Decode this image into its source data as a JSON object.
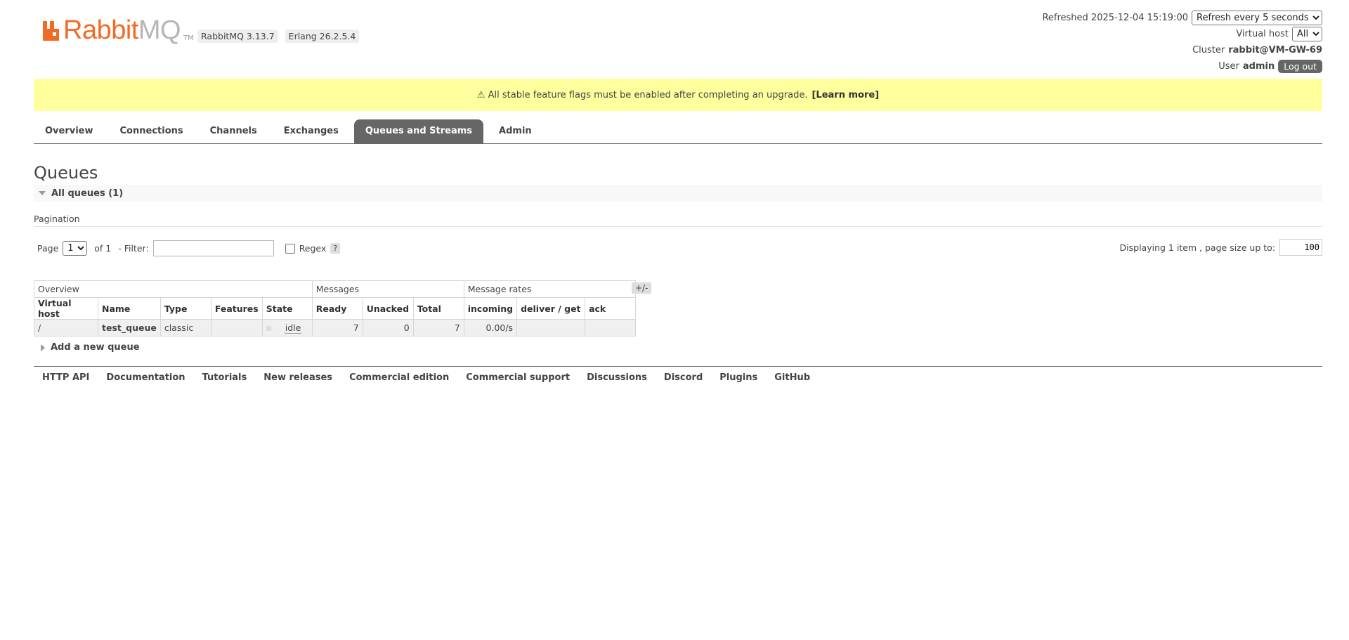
{
  "header": {
    "logo_rabbit": "Rabbit",
    "logo_mq": "MQ",
    "logo_tm": "TM",
    "rabbitmq_version": "RabbitMQ 3.13.7",
    "erlang_version": "Erlang 26.2.5.4"
  },
  "status": {
    "refreshed": "Refreshed 2025-12-04 15:19:00",
    "refresh_option": "Refresh every 5 seconds",
    "vhost_label": "Virtual host",
    "vhost_value": "All",
    "cluster_label": "Cluster",
    "cluster_value": "rabbit@VM-GW-69",
    "user_label": "User",
    "user_value": "admin",
    "logout": "Log out"
  },
  "banner": {
    "text": "⚠ All stable feature flags must be enabled after completing an upgrade.",
    "link": "[Learn more]"
  },
  "tabs": [
    "Overview",
    "Connections",
    "Channels",
    "Exchanges",
    "Queues and Streams",
    "Admin"
  ],
  "active_tab": "Queues and Streams",
  "page": {
    "title": "Queues",
    "section": "All queues (1)",
    "pagination_label": "Pagination",
    "page_label": "Page",
    "page_value": "1",
    "of_label": "of 1",
    "filter_label": "- Filter:",
    "filter_value": "",
    "regex_label": "Regex",
    "help": "?",
    "displaying": "Displaying 1 item , page size up to:",
    "page_size": "100"
  },
  "table": {
    "groups": [
      "Overview",
      "Messages",
      "Message rates"
    ],
    "toggle": "+/-",
    "columns": [
      "Virtual host",
      "Name",
      "Type",
      "Features",
      "State",
      "Ready",
      "Unacked",
      "Total",
      "incoming",
      "deliver / get",
      "ack"
    ],
    "rows": [
      {
        "vhost": "/",
        "name": "test_queue",
        "type": "classic",
        "features": "",
        "state": "idle",
        "ready": "7",
        "unacked": "0",
        "total": "7",
        "incoming": "0.00/s",
        "deliver_get": "",
        "ack": ""
      }
    ]
  },
  "add_queue": "Add a new queue",
  "footer": [
    "HTTP API",
    "Documentation",
    "Tutorials",
    "New releases",
    "Commercial edition",
    "Commercial support",
    "Discussions",
    "Discord",
    "Plugins",
    "GitHub"
  ],
  "colors": {
    "brand_orange": "#f26b26",
    "tab_active": "#666666",
    "banner_bg": "#ffff9e"
  }
}
